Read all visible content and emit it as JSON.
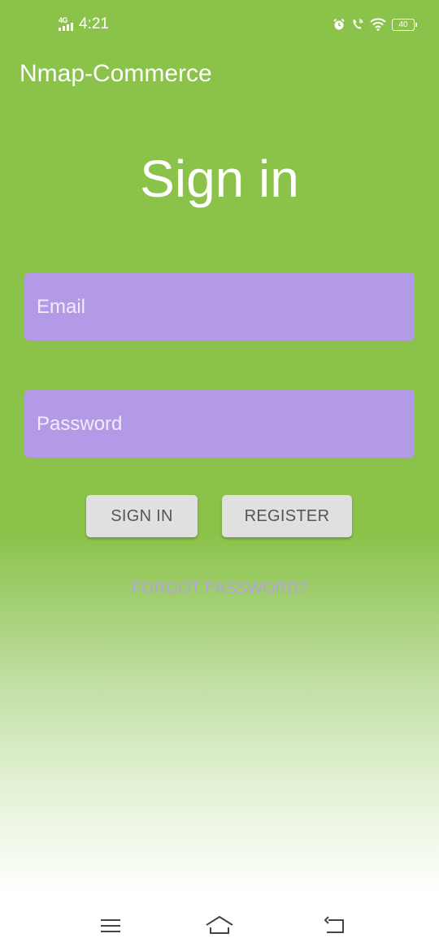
{
  "status_bar": {
    "network": "4G",
    "time": "4:21",
    "battery": "40",
    "icons": [
      "alarm-icon",
      "wifi-call-icon",
      "wifi-icon",
      "battery-icon"
    ]
  },
  "app_bar": {
    "title": "Nmap-Commerce"
  },
  "form": {
    "heading": "Sign in",
    "email_placeholder": "Email",
    "password_placeholder": "Password",
    "sign_in_label": "SIGN IN",
    "register_label": "REGISTER",
    "forgot_label": "FORGOT PASSWORD?"
  },
  "nav_bar": {
    "icons": [
      "menu-icon",
      "home-icon",
      "back-icon"
    ]
  },
  "colors": {
    "background": "#8bc34a",
    "input_fill": "#b39ae6",
    "button_fill": "#e0e0e0",
    "link_text": "#b3a4dd"
  }
}
